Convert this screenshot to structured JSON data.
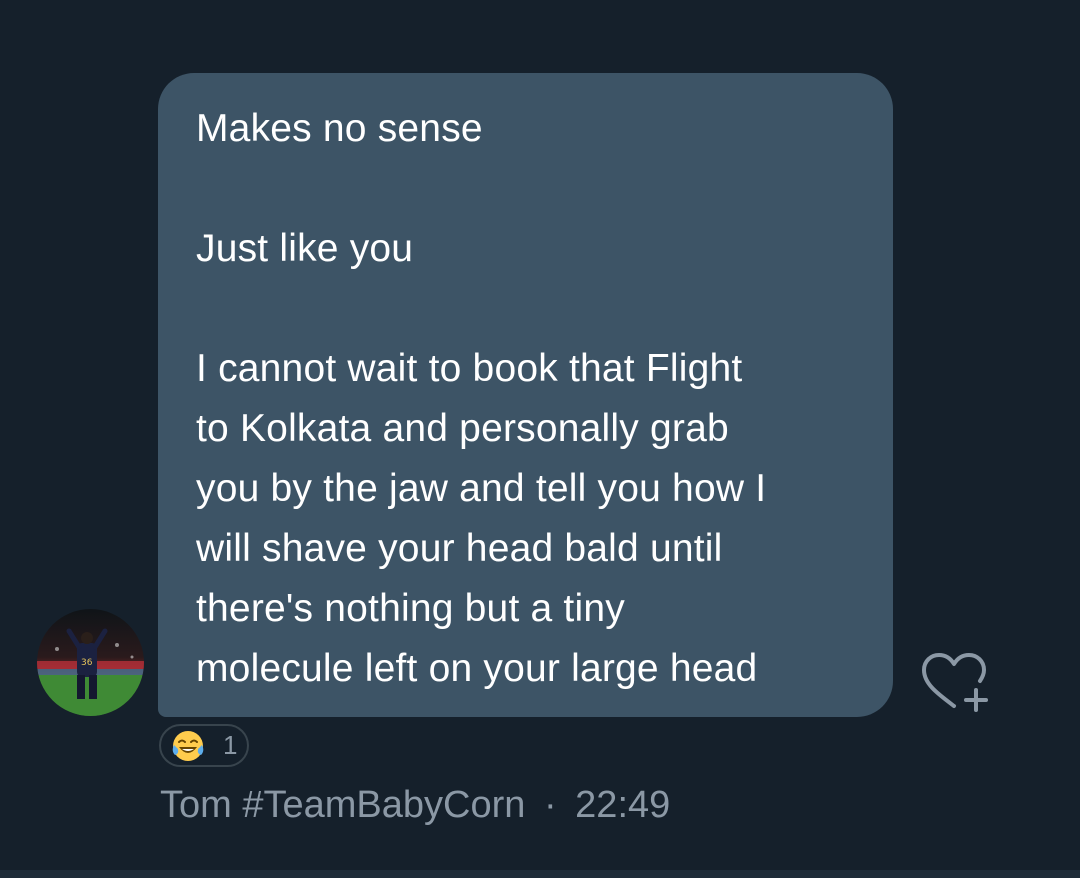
{
  "message": {
    "paragraphs": [
      [
        "Makes no sense"
      ],
      [
        "Just like you"
      ],
      [
        "I cannot wait to book that Flight",
        "to Kolkata and personally grab",
        "you by the jaw and tell you how I",
        "will shave your head bald until",
        "there's nothing but a tiny",
        "molecule left on your large head"
      ]
    ]
  },
  "reaction": {
    "emoji_icon": "face-with-tears-of-joy-icon",
    "count": "1"
  },
  "sender": {
    "name": "Tom #TeamBabyCorn",
    "separator": "·",
    "time": "22:49"
  },
  "react_button_icon": "heart-plus-icon",
  "colors": {
    "background": "#15202b",
    "bubble": "#3d5466",
    "muted_text": "#8b98a5",
    "border": "#38444d"
  }
}
